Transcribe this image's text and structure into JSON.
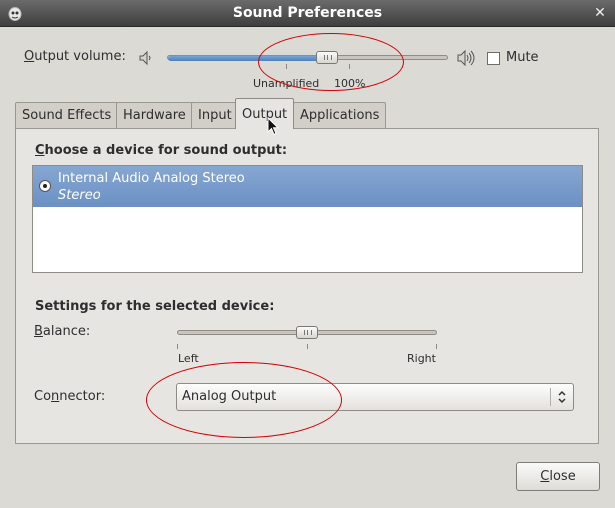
{
  "window": {
    "title": "Sound Preferences",
    "close_glyph": "✕"
  },
  "volume": {
    "label_mnemonic": "O",
    "label_rest": "utput volume:",
    "level_fraction": 0.57,
    "mark_unamplified": "Unamplified",
    "mark_100": "100%",
    "mute_label": "Mute",
    "mute_checked": false,
    "low_icon": "speaker-low-icon",
    "high_icon": "speaker-high-icon"
  },
  "tabs": [
    {
      "label": "Sound Effects",
      "active": false
    },
    {
      "label": "Hardware",
      "active": false
    },
    {
      "label": "Input",
      "active": false
    },
    {
      "label": "Output",
      "active": true
    },
    {
      "label": "Applications",
      "active": false
    }
  ],
  "output": {
    "heading_mnemonic": "C",
    "heading_rest": "hoose a device for sound output:",
    "devices": [
      {
        "name": "Internal Audio Analog Stereo",
        "profile": "Stereo",
        "selected": true
      }
    ],
    "settings_heading": "Settings for the selected device:",
    "balance_mnemonic": "B",
    "balance_rest": "alance:",
    "balance_fraction": 0.5,
    "balance_left": "Left",
    "balance_right": "Right",
    "connector_label_pre": "Co",
    "connector_mnemonic": "n",
    "connector_label_post": "nector:",
    "connector_value": "Analog Output"
  },
  "footer": {
    "close_mnemonic": "C",
    "close_rest": "lose"
  },
  "colors": {
    "annotation": "#d40000",
    "selection": "#6a90c4"
  }
}
